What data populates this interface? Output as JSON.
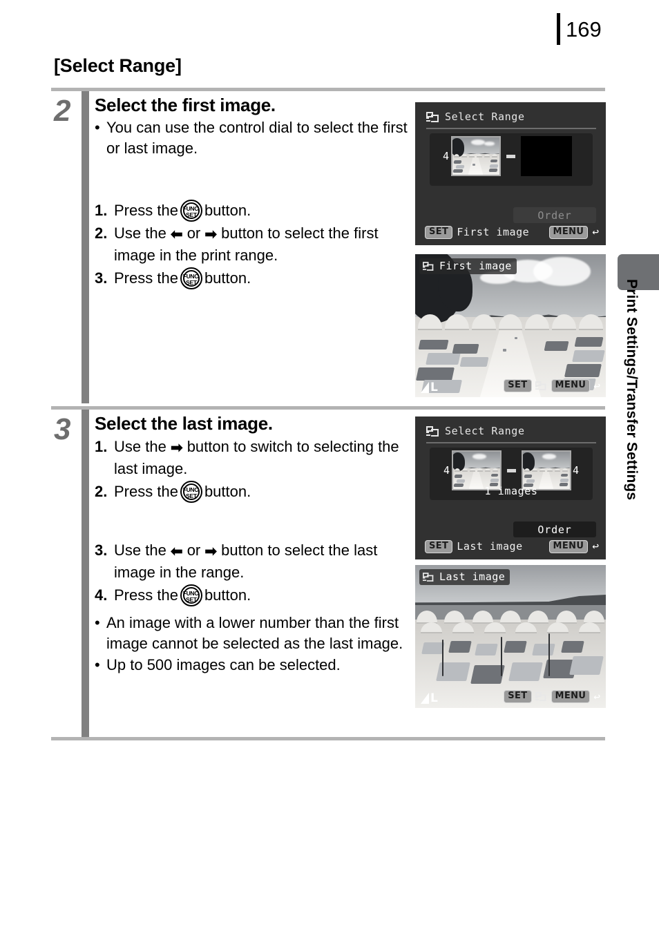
{
  "page": {
    "number": "169",
    "section_title": "[Select Range]",
    "side_tab_label": "Print Settings/Transfer Settings"
  },
  "steps": [
    {
      "number": "2",
      "heading": "Select the first image.",
      "bullets": [
        {
          "mark": "•",
          "text": "You can use the control dial to select the first or last image."
        }
      ],
      "items": [
        {
          "mark": "1.",
          "pre": "Press the",
          "post": "button.",
          "icon": "func-set-button"
        },
        {
          "mark": "2.",
          "pre": "Use the",
          "mid": "or",
          "post": "button to select the first image in the print range.",
          "icon": "left-right-arrow"
        },
        {
          "mark": "3.",
          "pre": "Press the",
          "post": "button.",
          "icon": "func-set-button"
        }
      ]
    },
    {
      "number": "3",
      "heading": "Select the last image.",
      "items_top": [
        {
          "mark": "1.",
          "pre": "Use the",
          "post": "button to switch to selecting the last image.",
          "icon": "right-arrow"
        },
        {
          "mark": "2.",
          "pre": "Press the",
          "post": "button.",
          "icon": "func-set-button"
        }
      ],
      "items_bottom": [
        {
          "mark": "3.",
          "pre": "Use the",
          "mid": "or",
          "post": "button to select the last image in the range.",
          "icon": "left-right-arrow"
        },
        {
          "mark": "4.",
          "pre": "Press the",
          "post": "button.",
          "icon": "func-set-button"
        }
      ],
      "bullets": [
        {
          "mark": "•",
          "text": "An image with a lower number than the first image cannot be selected as the last image."
        },
        {
          "mark": "•",
          "text": "Up to 500 images can be selected."
        }
      ]
    }
  ],
  "arrows": {
    "left": "⬅",
    "right": "➡"
  },
  "func_set": {
    "top": "FUNC.",
    "bottom": "SET"
  },
  "lcd_screens": [
    {
      "id": "select-range-first",
      "type": "menu",
      "title": "Select Range",
      "thumb_left_number": "4",
      "thumb_right_number": "",
      "image_count_label": "",
      "order_label": "Order",
      "order_state": "dimmed",
      "footer_key": "SET",
      "footer_label": "First image",
      "menu_key": "MENU",
      "return_arrow": "↩"
    },
    {
      "id": "first-image-preview",
      "type": "photo",
      "badge_label": "First image",
      "quality_label": "L",
      "footer_key": "SET",
      "menu_key": "MENU",
      "return_arrow": "↩"
    },
    {
      "id": "select-range-last",
      "type": "menu",
      "title": "Select Range",
      "thumb_left_number": "4",
      "thumb_right_number": "4",
      "image_count_label": "1 images",
      "order_label": "Order",
      "order_state": "active",
      "footer_key": "SET",
      "footer_label": "Last image",
      "menu_key": "MENU",
      "return_arrow": "↩"
    },
    {
      "id": "last-image-preview",
      "type": "photo",
      "badge_label": "Last image",
      "quality_label": "L",
      "footer_key": "SET",
      "menu_key": "MENU",
      "return_arrow": "↩"
    }
  ],
  "colors": {
    "rule_gray": "#b3b3b3",
    "step_bar_gray": "#808080",
    "step_number_gray": "#6e6e6e",
    "side_tab_gray": "#6e7073",
    "lcd_background": "#313131"
  }
}
